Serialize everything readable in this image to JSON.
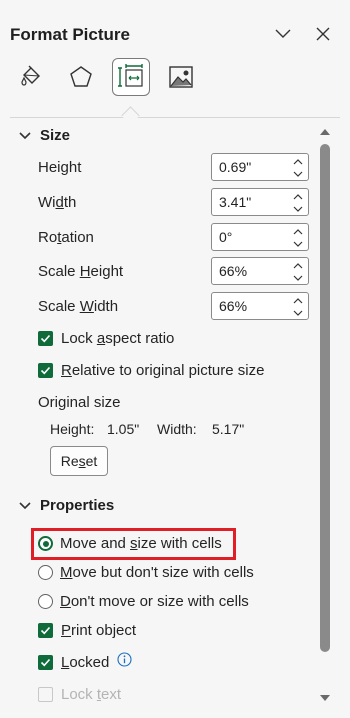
{
  "header": {
    "title": "Format Picture",
    "collapse_icon": "chevron-down-icon",
    "close_icon": "close-icon"
  },
  "tabs": [
    {
      "name": "fill-line",
      "icon": "paint-bucket-icon",
      "active": false
    },
    {
      "name": "effects",
      "icon": "pentagon-icon",
      "active": false
    },
    {
      "name": "size-properties",
      "icon": "size-properties-icon",
      "active": true
    },
    {
      "name": "picture",
      "icon": "picture-icon",
      "active": false
    }
  ],
  "size_section": {
    "title": "Size",
    "height": {
      "label_pre": "Hei",
      "label_u": "g",
      "label_post": "ht",
      "value": "0.69\""
    },
    "width": {
      "label_pre": "Wi",
      "label_u": "d",
      "label_post": "th",
      "value": "3.41\""
    },
    "rotation": {
      "label_pre": "Ro",
      "label_u": "t",
      "label_post": "ation",
      "value": "0°"
    },
    "scale_height": {
      "label_pre": "Scale ",
      "label_u": "H",
      "label_post": "eight",
      "value": "66%"
    },
    "scale_width": {
      "label_pre": "Scale ",
      "label_u": "W",
      "label_post": "idth",
      "value": "66%"
    },
    "lock_aspect": {
      "label_pre": "Lock ",
      "label_u": "a",
      "label_post": "spect ratio",
      "checked": true
    },
    "relative_original": {
      "label_pre": "",
      "label_u": "R",
      "label_post": "elative to original picture size",
      "checked": true
    },
    "original_size_label": "Original size",
    "original_height_label": "Height:",
    "original_height_value": "1.05\"",
    "original_width_label": "Width:",
    "original_width_value": "5.17\"",
    "reset_pre": "Re",
    "reset_u": "s",
    "reset_post": "et"
  },
  "properties_section": {
    "title": "Properties",
    "move_size": {
      "label_pre": "Move and ",
      "label_u": "s",
      "label_post": "ize with cells",
      "selected": true
    },
    "move_no_size": {
      "label_pre": "",
      "label_u": "M",
      "label_post": "ove but don't size with cells",
      "selected": false
    },
    "no_move_size": {
      "label_pre": "",
      "label_u": "D",
      "label_post": "on't move or size with cells",
      "selected": false
    },
    "print_object": {
      "label_pre": "",
      "label_u": "P",
      "label_post": "rint object",
      "checked": true
    },
    "locked": {
      "label_pre": "",
      "label_u": "L",
      "label_post": "ocked",
      "checked": true
    },
    "lock_text": {
      "label_pre": "Lock ",
      "label_u": "t",
      "label_post": "ext",
      "checked": false,
      "disabled": true
    }
  },
  "colors": {
    "accent": "#0f6b3a",
    "highlight": "#e01e26",
    "background": "#f6f6f6"
  }
}
